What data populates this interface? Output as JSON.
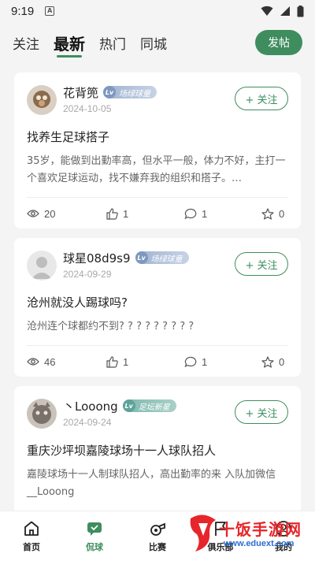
{
  "status_bar": {
    "time": "9:19",
    "badge": "A"
  },
  "top_tabs": [
    {
      "label": "关注"
    },
    {
      "label": "最新"
    },
    {
      "label": "热门"
    },
    {
      "label": "同城"
    }
  ],
  "post_button": "发帖",
  "posts": [
    {
      "username": "花背篼",
      "level": "Lv",
      "badge": "场绿球童",
      "date": "2024-10-05",
      "follow": "+ 关注",
      "title": "找养生足球搭子",
      "body": "35岁，能做到出勤率高，但水平一般，体力不好，主打一个喜欢足球运动，找不嫌弃我的组织和搭子。…",
      "views": "20",
      "likes": "1",
      "comments": "1",
      "favorites": "0"
    },
    {
      "username": "球星08d9s9",
      "level": "Lv",
      "badge": "场绿球童",
      "date": "2024-09-29",
      "follow": "+ 关注",
      "title": "沧州就没人踢球吗?",
      "body": "沧州连个球都约不到? ? ? ? ? ? ? ? ?",
      "views": "46",
      "likes": "1",
      "comments": "1",
      "favorites": "0"
    },
    {
      "username": "丶Looong",
      "level": "Lv",
      "badge": "足坛新星",
      "date": "2024-09-24",
      "follow": "+ 关注",
      "title": "重庆沙坪坝嘉陵球场十一人球队招人",
      "body": "嘉陵球场十一人制球队招人，高出勤率的来 入队加微信__Looong"
    }
  ],
  "bottom_nav": [
    {
      "label": "首页",
      "icon": "home-icon"
    },
    {
      "label": "侃球",
      "icon": "chat-icon"
    },
    {
      "label": "比赛",
      "icon": "whistle-icon"
    },
    {
      "label": "俱乐部",
      "icon": "flag-icon"
    },
    {
      "label": "我的",
      "icon": "user-icon"
    }
  ],
  "watermark": {
    "text": "十饭手游网",
    "url": "www.eduext.com"
  },
  "colors": {
    "accent": "#3f8d5f",
    "background": "#f3f4f3",
    "card": "#ffffff"
  }
}
